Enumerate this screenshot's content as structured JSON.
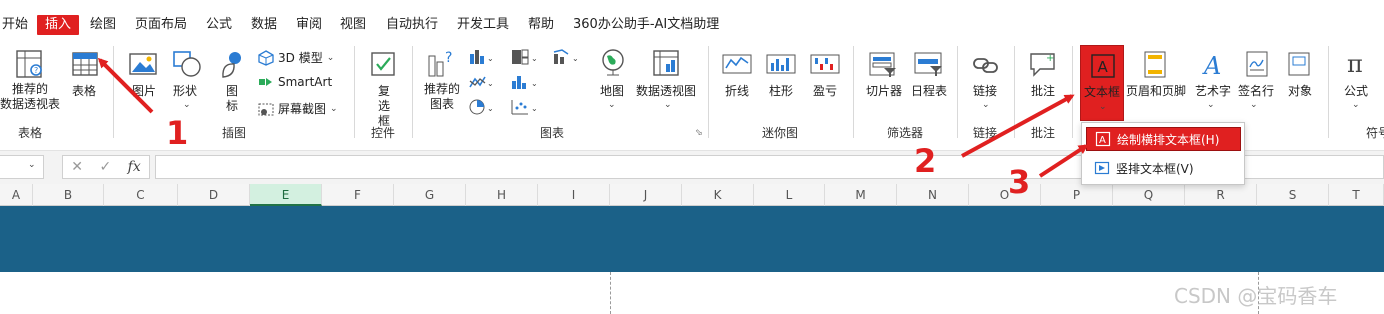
{
  "menu": {
    "items": [
      "开始",
      "插入",
      "绘图",
      "页面布局",
      "公式",
      "数据",
      "审阅",
      "视图",
      "自动执行",
      "开发工具",
      "帮助",
      "360办公助手-AI文档助理"
    ],
    "active": "插入"
  },
  "ribbon": {
    "buttons": {
      "pivot_table": "推荐的\n数据透视表",
      "table": "表格",
      "pictures": "图片",
      "shapes": "形状",
      "icons": "图\n标",
      "model3d": "3D 模型",
      "smartart": "SmartArt",
      "screenshot": "屏幕截图",
      "checkbox": "复\n选框",
      "rec_charts": "推荐的\n图表",
      "maps": "地图",
      "pivot_chart": "数据透视图",
      "spark_line": "折线",
      "spark_column": "柱形",
      "spark_winloss": "盈亏",
      "slicer": "切片器",
      "timeline": "日程表",
      "link": "链接",
      "comment": "批注",
      "textbox": "文本框",
      "header_footer": "页眉和页脚",
      "wordart": "艺术字",
      "signature": "签名行",
      "object": "对象",
      "equation": "公式"
    },
    "groups": {
      "tables": "表格",
      "illustrations": "插图",
      "controls": "控件",
      "charts": "图表",
      "sparklines": "迷你图",
      "filters": "筛选器",
      "links": "链接",
      "comments": "批注",
      "symbols": "符号"
    },
    "colors": {
      "accent_red": "#e02020",
      "banner_blue": "#1b6188"
    }
  },
  "formula_bar": {
    "fx": "fx"
  },
  "columns": [
    "A",
    "B",
    "C",
    "D",
    "E",
    "F",
    "G",
    "H",
    "I",
    "J",
    "K",
    "L",
    "M",
    "N",
    "O",
    "P",
    "Q",
    "R",
    "S",
    "T"
  ],
  "selected_column": "E",
  "dropdown": {
    "items": [
      {
        "label": "绘制横排文本框(H)",
        "highlighted": true
      },
      {
        "label": "竖排文本框(V)",
        "highlighted": false
      }
    ]
  },
  "annotations": {
    "step1": "1",
    "step2": "2",
    "step3": "3"
  },
  "watermark": "CSDN @宝码香车"
}
